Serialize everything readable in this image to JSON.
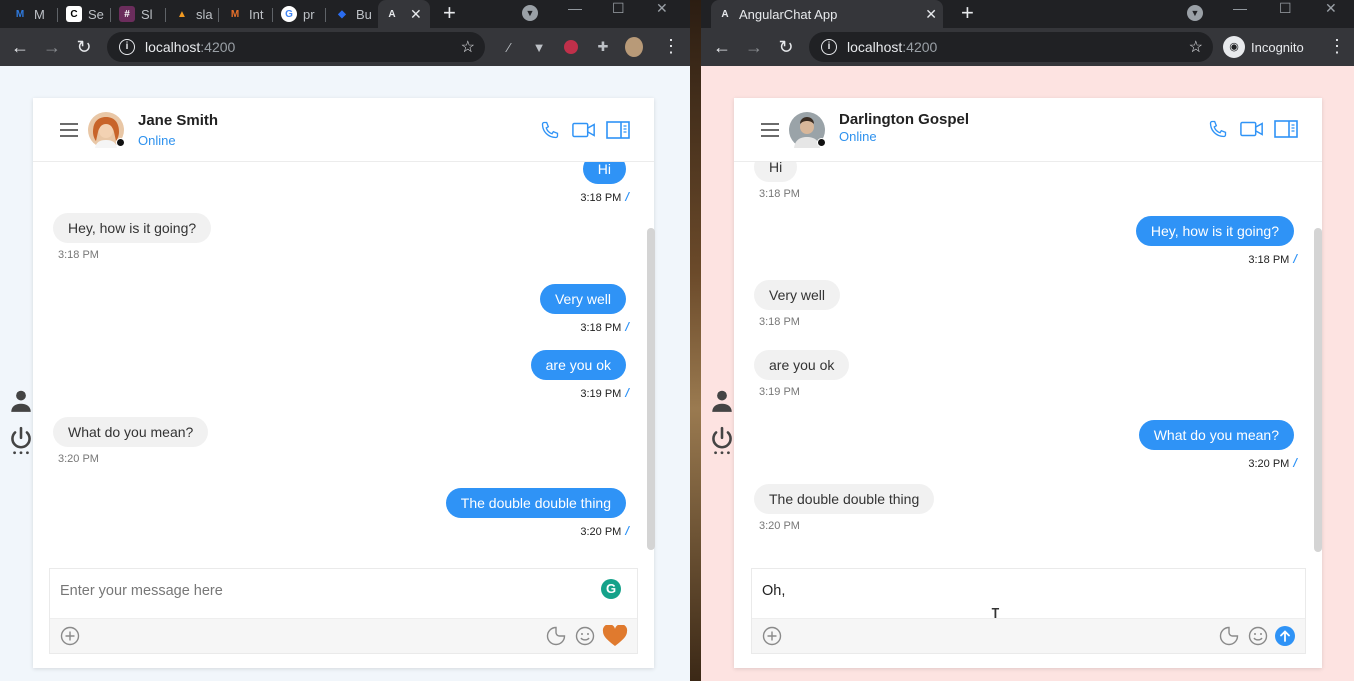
{
  "left_window": {
    "tabs": [
      {
        "label": "M",
        "color": "#2f7be0",
        "glyph": "M"
      },
      {
        "label": "Se",
        "color": "#ffffff",
        "glyph": "C"
      },
      {
        "label": "Sl",
        "color": "#b83a7a",
        "glyph": "#"
      },
      {
        "label": "sla",
        "color": "#f29a21",
        "glyph": "▲"
      },
      {
        "label": "Int",
        "color": "#e8702a",
        "glyph": "M"
      },
      {
        "label": "pr",
        "color": "#ffffff",
        "glyph": "G"
      },
      {
        "label": "Bu",
        "color": "#2a6cf0",
        "glyph": "◆"
      },
      {
        "label": "",
        "color": "#e8eaed",
        "glyph": "A"
      }
    ],
    "url_host": "localhost",
    "url_port": ":4200",
    "contact": {
      "name": "Jane Smith",
      "status": "Online"
    },
    "messages": [
      {
        "dir": "out",
        "text": "Hi",
        "time": "3:18 PM"
      },
      {
        "dir": "in",
        "text": "Hey, how is it going?",
        "time": "3:18 PM"
      },
      {
        "dir": "out",
        "text": "Very well",
        "time": "3:18 PM"
      },
      {
        "dir": "out",
        "text": "are you ok",
        "time": "3:19 PM"
      },
      {
        "dir": "in",
        "text": "What do you mean?",
        "time": "3:20 PM"
      },
      {
        "dir": "out",
        "text": "The double double thing",
        "time": "3:20 PM"
      }
    ],
    "composer": {
      "placeholder": "Enter your message here",
      "value": ""
    }
  },
  "right_window": {
    "tab_title": "AngularChat App",
    "url_host": "localhost",
    "url_port": ":4200",
    "profile_label": "Incognito",
    "contact": {
      "name": "Darlington Gospel",
      "status": "Online"
    },
    "messages": [
      {
        "dir": "in",
        "text": "Hi",
        "time": "3:18 PM"
      },
      {
        "dir": "out",
        "text": "Hey, how is it going?",
        "time": "3:18 PM"
      },
      {
        "dir": "in",
        "text": "Very well",
        "time": "3:18 PM"
      },
      {
        "dir": "in",
        "text": "are you ok",
        "time": "3:19 PM"
      },
      {
        "dir": "out",
        "text": "What do you mean?",
        "time": "3:20 PM"
      },
      {
        "dir": "in",
        "text": "The double double thing",
        "time": "3:20 PM"
      }
    ],
    "composer": {
      "placeholder": "Enter your message here",
      "value": "Oh,"
    }
  },
  "colors": {
    "accent": "#2f93f6",
    "send": "#2f93f6",
    "heart": "#e07a2e"
  }
}
